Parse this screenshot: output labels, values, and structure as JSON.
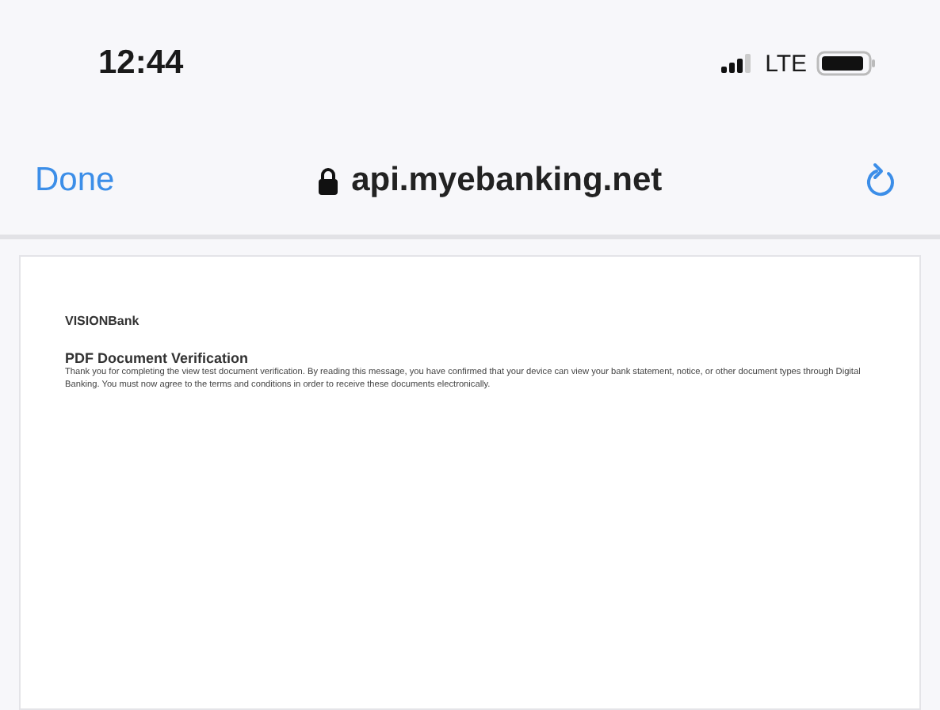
{
  "status_bar": {
    "time": "12:44",
    "network": "LTE"
  },
  "nav_bar": {
    "done": "Done",
    "url": "api.myebanking.net"
  },
  "document": {
    "brand": "VISIONBank",
    "heading": "PDF Document Verification",
    "body": "Thank you for completing the view test document verification. By reading this message, you have confirmed that your device can view your bank statement, notice, or other document types through Digital Banking. You must now agree to the terms and conditions in order to receive these documents electronically."
  }
}
